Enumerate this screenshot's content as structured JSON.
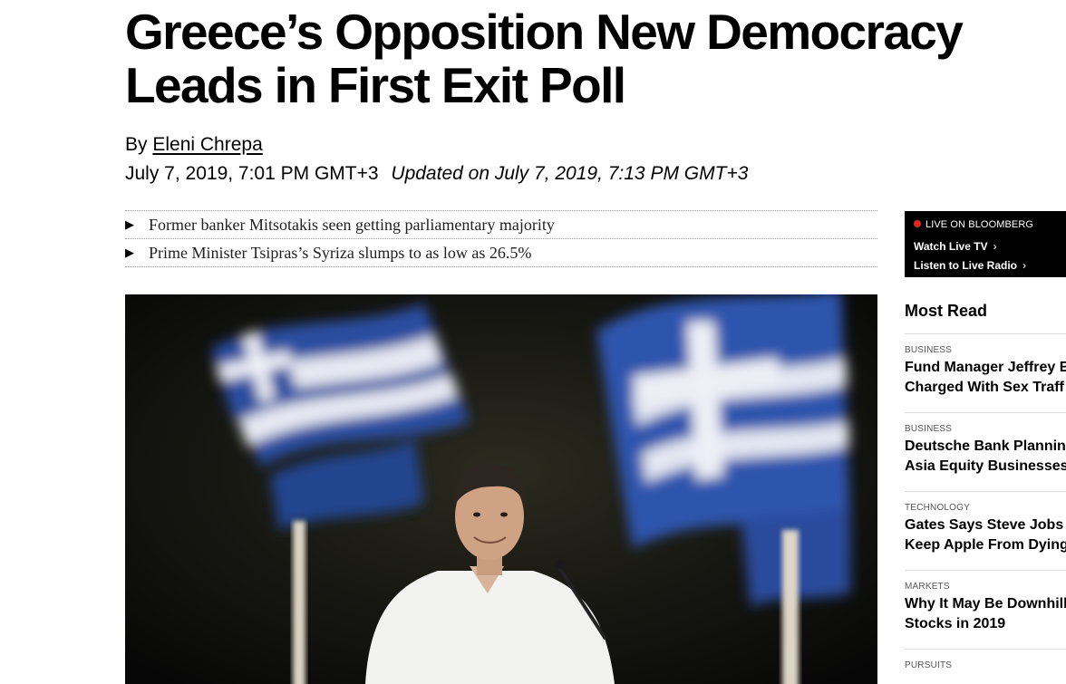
{
  "article": {
    "headline_line1": "Greece’s Opposition New Democracy",
    "headline_line2": "Leads in First Exit Poll",
    "byline_prefix": "By",
    "author": "Eleni Chrepa",
    "published": "July 7, 2019, 7:01 PM GMT+3",
    "updated": "Updated on July 7, 2019, 7:13 PM GMT+3",
    "bullets": [
      "Former banker Mitsotakis seen getting parliamentary majority",
      "Prime Minister Tsipras’s Syriza slumps to as low as 26.5%"
    ],
    "bullet_icon": "triangle-right-icon"
  },
  "live": {
    "tag": "LIVE ON BLOOMBERG",
    "watch": "Watch Live TV",
    "listen": "Listen to Live Radio",
    "chevron": "›",
    "accent_color": "#e1261c"
  },
  "most_read": {
    "title": "Most Read",
    "items": [
      {
        "category": "BUSINESS",
        "line1": "Fund Manager Jeffrey E",
        "line2": "Charged With Sex Traff"
      },
      {
        "category": "BUSINESS",
        "line1": "Deutsche Bank Plannin",
        "line2": "Asia Equity Businesses"
      },
      {
        "category": "TECHNOLOGY",
        "line1": "Gates Says Steve Jobs",
        "line2": "Keep Apple From Dying"
      },
      {
        "category": "MARKETS",
        "line1": "Why It May Be Downhill",
        "line2": "Stocks in 2019"
      },
      {
        "category": "PURSUITS",
        "line1": "",
        "line2": ""
      }
    ]
  }
}
